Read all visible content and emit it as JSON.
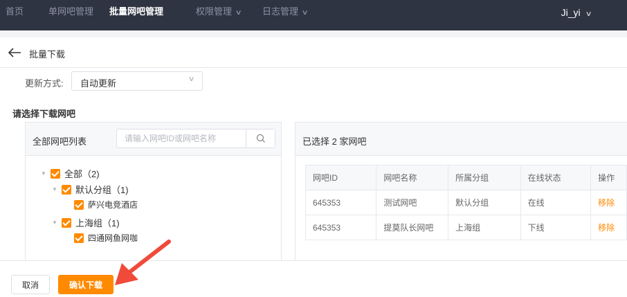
{
  "nav": {
    "items": [
      {
        "label": "首页",
        "active": false,
        "dropdown": false
      },
      {
        "label": "单网吧管理",
        "active": false,
        "dropdown": false
      },
      {
        "label": "批量网吧管理",
        "active": true,
        "dropdown": false
      },
      {
        "label": "权限管理",
        "active": false,
        "dropdown": true
      },
      {
        "label": "日志管理",
        "active": false,
        "dropdown": true
      }
    ],
    "user": "Ji_yi"
  },
  "header": {
    "title": "批量下载"
  },
  "update_mode": {
    "label": "更新方式:",
    "value": "自动更新"
  },
  "section_title": "请选择下载网吧",
  "left_panel": {
    "title": "全部网吧列表",
    "search_placeholder": "请输入网吧ID或网吧名称",
    "tree": {
      "root": "全部（2)",
      "groups": [
        {
          "label": "默认分组（1)",
          "children": [
            "萨兴电竞酒店"
          ]
        },
        {
          "label": "上海组（1)",
          "children": [
            "四通网鱼网咖"
          ]
        }
      ]
    }
  },
  "right_panel": {
    "title": "已选择 2 家网吧",
    "columns": [
      "网吧ID",
      "网吧名称",
      "所属分组",
      "在线状态",
      "操作"
    ],
    "rows": [
      {
        "id": "645353",
        "name": "测试网吧",
        "group": "默认分组",
        "status": "在线",
        "action": "移除"
      },
      {
        "id": "645353",
        "name": "提莫队长网吧",
        "group": "上海组",
        "status": "下线",
        "action": "移除"
      }
    ]
  },
  "footer": {
    "cancel": "取消",
    "confirm": "确认下载"
  },
  "colors": {
    "nav_bg": "#2f3443",
    "accent": "#ff8a00",
    "annotation": "#f04a3a"
  }
}
